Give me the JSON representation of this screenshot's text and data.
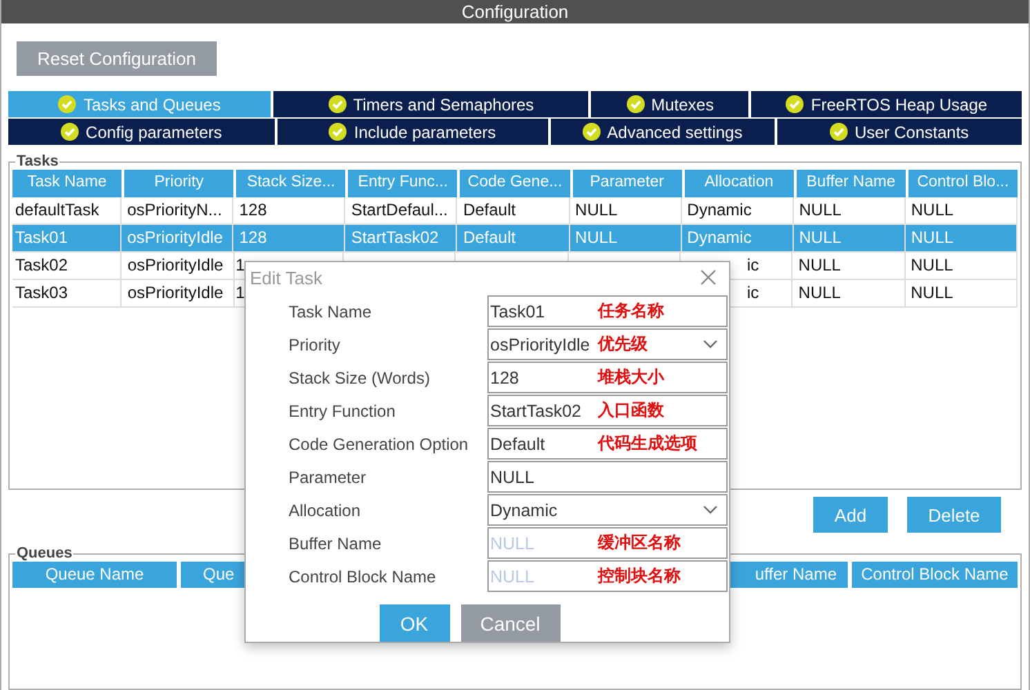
{
  "window": {
    "title": "Configuration"
  },
  "reset_button": "Reset Configuration",
  "tab_rows": [
    [
      {
        "label": "Tasks and Queues",
        "selected": true
      },
      {
        "label": "Timers and Semaphores",
        "selected": false
      },
      {
        "label": "Mutexes",
        "selected": false
      },
      {
        "label": "FreeRTOS Heap Usage",
        "selected": false
      }
    ],
    [
      {
        "label": "Config parameters",
        "selected": false
      },
      {
        "label": "Include parameters",
        "selected": false
      },
      {
        "label": "Advanced settings",
        "selected": false
      },
      {
        "label": "User Constants",
        "selected": false
      }
    ]
  ],
  "tasks": {
    "legend": "Tasks",
    "columns": [
      "Task Name",
      "Priority",
      "Stack Size...",
      "Entry Func...",
      "Code Gene...",
      "Parameter",
      "Allocation",
      "Buffer Name",
      "Control Blo..."
    ],
    "rows": [
      {
        "selected": false,
        "cells": [
          "defaultTask",
          "osPriorityN...",
          "128",
          "StartDefaul...",
          "Default",
          "NULL",
          "Dynamic",
          "NULL",
          "NULL"
        ]
      },
      {
        "selected": true,
        "cells": [
          "Task01",
          "osPriorityIdle",
          "128",
          "StartTask02",
          "Default",
          "NULL",
          "Dynamic",
          "NULL",
          "NULL"
        ]
      },
      {
        "selected": false,
        "cells": [
          "Task02",
          "osPriorityIdle",
          "1",
          "",
          "",
          "",
          "ic",
          "NULL",
          "NULL"
        ]
      },
      {
        "selected": false,
        "cells": [
          "Task03",
          "osPriorityIdle",
          "1",
          "",
          "",
          "",
          "ic",
          "NULL",
          "NULL"
        ]
      }
    ],
    "buttons": [
      "Add",
      "Delete"
    ]
  },
  "queues": {
    "legend": "Queues",
    "columns": [
      "Queue Name",
      "Que",
      "uffer Name",
      "Control Block Name"
    ]
  },
  "dialog": {
    "title": "Edit Task",
    "fields": [
      {
        "label": "Task Name",
        "kind": "text",
        "value": "Task01",
        "note": "任务名称"
      },
      {
        "label": "Priority",
        "kind": "select",
        "value": "osPriorityIdle",
        "note": "优先级"
      },
      {
        "label": "Stack Size (Words)",
        "kind": "text",
        "value": "128",
        "note": "堆栈大小"
      },
      {
        "label": "Entry Function",
        "kind": "text",
        "value": "StartTask02",
        "note": "入口函数"
      },
      {
        "label": "Code Generation Option",
        "kind": "text",
        "value": "Default",
        "note": "代码生成选项"
      },
      {
        "label": "Parameter",
        "kind": "text",
        "value": "NULL"
      },
      {
        "label": "Allocation",
        "kind": "select",
        "value": "Dynamic"
      },
      {
        "label": "Buffer Name",
        "kind": "text",
        "placeholder": "NULL",
        "note": "缓冲区名称"
      },
      {
        "label": "Control Block Name",
        "kind": "text",
        "placeholder": "NULL",
        "note": "控制块名称"
      }
    ],
    "buttons": [
      {
        "label": "OK",
        "kind": "primary"
      },
      {
        "label": "Cancel",
        "kind": "secondary"
      }
    ]
  }
}
